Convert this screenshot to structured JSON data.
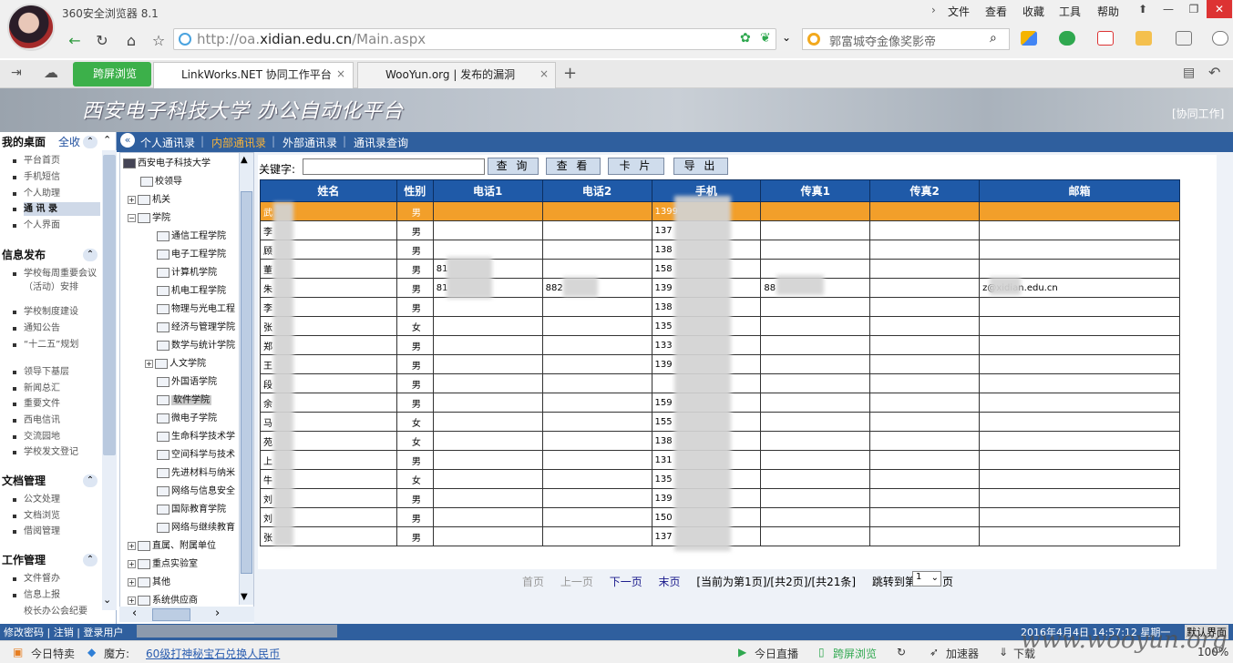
{
  "browser": {
    "app_name": "360安全浏览器 8.1",
    "menus": [
      "文件",
      "查看",
      "收藏",
      "工具",
      "帮助"
    ],
    "url_prefix": "http://oa.",
    "url_domain": "xidian.edu.cn",
    "url_path": "/Main.aspx",
    "search_text": "郭富城夺金像奖影帝",
    "cross_browse": "跨屏浏览",
    "tabs": [
      "LinkWorks.NET 协同工作平台",
      "WooYun.org | 发布的漏洞"
    ]
  },
  "banner": {
    "title": "西安电子科技大学 办公自动化平台",
    "right": "[协同工作]"
  },
  "left_panel": {
    "sections": [
      {
        "title": "我的桌面",
        "action": "全收",
        "items": [
          "平台首页",
          "手机短信",
          "个人助理",
          "通 讯 录",
          "个人界面"
        ]
      },
      {
        "title": "信息发布",
        "items": [
          "学校每周重要会议（活动）安排",
          "学校制度建设",
          "通知公告",
          "“十二五”规划",
          "领导下基层",
          "新闻总汇",
          "重要文件",
          "西电信讯",
          "交流园地",
          "学校发文登记"
        ]
      },
      {
        "title": "文档管理",
        "items": [
          "公文处理",
          "文档浏览",
          "借阅管理"
        ]
      },
      {
        "title": "工作管理",
        "items": [
          "文件督办",
          "信息上报",
          "校长办公会纪要"
        ]
      }
    ]
  },
  "subnav": [
    "个人通讯录",
    "内部通讯录",
    "外部通讯录",
    "通讯录查询"
  ],
  "tree": {
    "root": "西安电子科技大学",
    "nodes": [
      "校领导",
      "机关",
      "学院",
      "通信工程学院",
      "电子工程学院",
      "计算机学院",
      "机电工程学院",
      "物理与光电工程",
      "经济与管理学院",
      "数学与统计学院",
      "人文学院",
      "外国语学院",
      "软件学院",
      "微电子学院",
      "生命科学技术学",
      "空间科学与技术",
      "先进材料与纳米",
      "网络与信息安全",
      "国际教育学院",
      "网络与继续教育",
      "直属、附属单位",
      "重点实验室",
      "其他",
      "系统供应商"
    ]
  },
  "search": {
    "label": "关键字:",
    "buttons": [
      "查 询",
      "查 看",
      "卡 片",
      "导 出"
    ]
  },
  "table": {
    "headers": [
      "姓名",
      "性别",
      "电话1",
      "电话2",
      "手机",
      "传真1",
      "传真2",
      "邮箱"
    ],
    "rows": [
      [
        "武",
        "男",
        "",
        "",
        "1399",
        "",
        "",
        ""
      ],
      [
        "李",
        "男",
        "",
        "",
        "137",
        "",
        "",
        ""
      ],
      [
        "顾",
        "男",
        "",
        "",
        "138",
        "",
        "",
        ""
      ],
      [
        "董",
        "男",
        "81",
        "",
        "158",
        "",
        "",
        ""
      ],
      [
        "朱",
        "男",
        "81",
        "882",
        "139",
        "88",
        "",
        "z@xidian.edu.cn"
      ],
      [
        "李",
        "男",
        "",
        "",
        "138",
        "",
        "",
        ""
      ],
      [
        "张",
        "女",
        "",
        "",
        "135",
        "",
        "",
        ""
      ],
      [
        "郑",
        "男",
        "",
        "",
        "133",
        "",
        "",
        ""
      ],
      [
        "王",
        "男",
        "",
        "",
        "139",
        "",
        "",
        ""
      ],
      [
        "段",
        "男",
        "",
        "",
        "",
        "",
        "",
        ""
      ],
      [
        "余",
        "男",
        "",
        "",
        "159",
        "",
        "",
        ""
      ],
      [
        "马",
        "女",
        "",
        "",
        "155",
        "",
        "",
        ""
      ],
      [
        "苑",
        "女",
        "",
        "",
        "138",
        "",
        "",
        ""
      ],
      [
        "上",
        "男",
        "",
        "",
        "131",
        "",
        "",
        ""
      ],
      [
        "牛",
        "女",
        "",
        "",
        "135",
        "",
        "",
        ""
      ],
      [
        "刘",
        "男",
        "",
        "",
        "139",
        "",
        "",
        ""
      ],
      [
        "刘",
        "男",
        "",
        "",
        "150",
        "",
        "",
        ""
      ],
      [
        "张",
        "男",
        "",
        "",
        "137",
        "",
        "",
        ""
      ]
    ]
  },
  "pager": {
    "first": "首页",
    "prev": "上一页",
    "next": "下一页",
    "last": "末页",
    "info": "[当前为第1页]/[共2页]/[共21条]",
    "jump_prefix": "跳转到第",
    "jump_value": "1",
    "jump_suffix": "页"
  },
  "status": {
    "left": "修改密码 | 注销 | 登录用户",
    "right": "2016年4月4日 14:57:12 星期一",
    "btn": "默认界面"
  },
  "bottom": {
    "items": [
      "今日特卖",
      "魔方:",
      "60级打神秘宝石兑换人民币",
      "今日直播",
      "跨屏浏览",
      "加速器",
      "下载",
      "100%"
    ]
  },
  "watermark": "www.wooyun.org"
}
